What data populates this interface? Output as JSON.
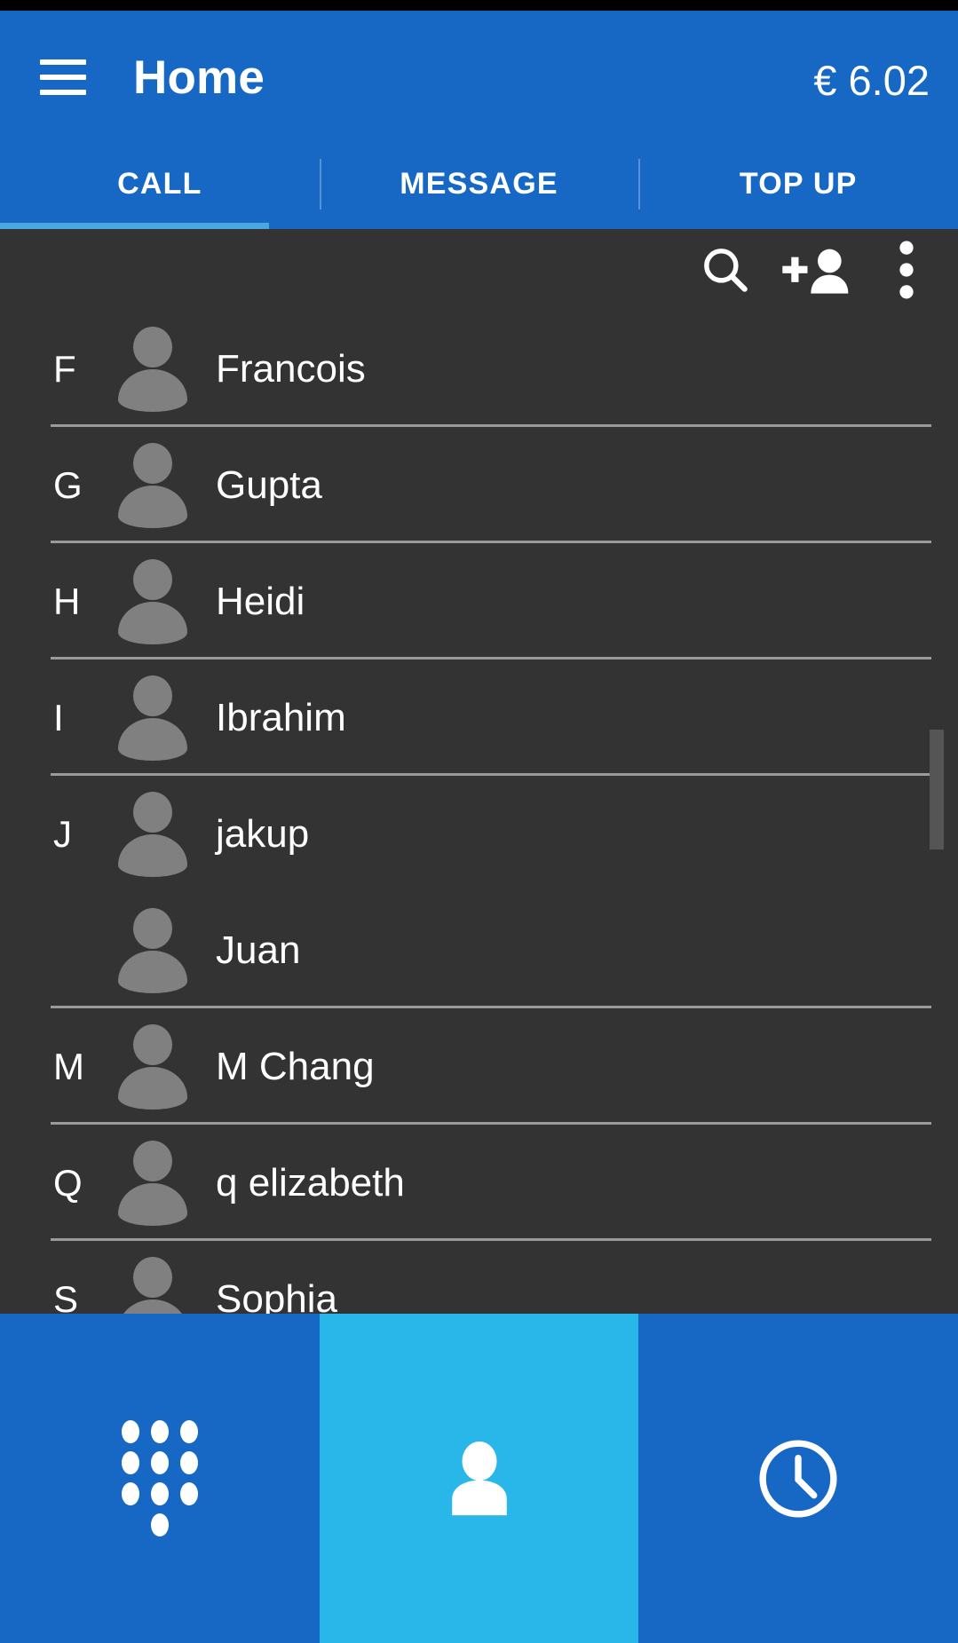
{
  "header": {
    "menu_icon": "hamburger-menu-icon",
    "title": "Home",
    "balance": "€ 6.02"
  },
  "tabs": [
    {
      "label": "CALL",
      "active": true
    },
    {
      "label": "MESSAGE",
      "active": false
    },
    {
      "label": "TOP UP",
      "active": false
    }
  ],
  "toolbar": {
    "search_icon": "search-icon",
    "add_contact_icon": "add-person-icon",
    "overflow_icon": "overflow-menu-icon"
  },
  "contacts": [
    {
      "section": "F",
      "name": "Francois",
      "divider": true
    },
    {
      "section": "G",
      "name": "Gupta",
      "divider": true
    },
    {
      "section": "H",
      "name": "Heidi",
      "divider": true
    },
    {
      "section": "I",
      "name": "Ibrahim",
      "divider": true
    },
    {
      "section": "J",
      "name": "jakup",
      "divider": false
    },
    {
      "section": "",
      "name": "Juan",
      "divider": true
    },
    {
      "section": "M",
      "name": "M Chang",
      "divider": true
    },
    {
      "section": "Q",
      "name": "q elizabeth",
      "divider": true
    },
    {
      "section": "S",
      "name": "Sophia",
      "divider": false
    }
  ],
  "bottom_nav": [
    {
      "icon": "dialpad-icon",
      "active": false
    },
    {
      "icon": "contacts-person-icon",
      "active": true
    },
    {
      "icon": "recents-clock-icon",
      "active": false
    }
  ],
  "colors": {
    "header_blue": "#1668c4",
    "tab_indicator": "#4aa8e0",
    "content_dark": "#333333",
    "nav_active": "#29b6e8",
    "avatar_gray": "#808080",
    "divider_gray": "#9a9a9a",
    "scroll_thumb": "#555555"
  }
}
